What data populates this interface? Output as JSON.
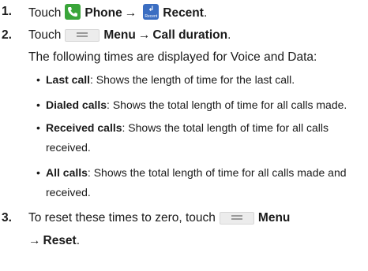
{
  "steps": [
    {
      "number": "1.",
      "prefix": "Touch",
      "phone_label": "Phone",
      "arrow": "→",
      "recent_label": "Recent",
      "recent_icon_caption": "Recent",
      "suffix": "."
    },
    {
      "number": "2.",
      "prefix": "Touch",
      "menu_label": "Menu",
      "arrow": "→",
      "target_label": "Call duration",
      "suffix": "."
    },
    {
      "number": "3.",
      "text": "To reset these times to zero, touch",
      "menu_label": "Menu",
      "arrow": "→",
      "target_label": "Reset",
      "suffix": "."
    }
  ],
  "intro": "The following times are displayed for Voice and Data:",
  "bullets": [
    {
      "term": "Last call",
      "desc": ": Shows the length of time for the last call."
    },
    {
      "term": "Dialed calls",
      "desc": ": Shows the total length of time for all calls made."
    },
    {
      "term": "Received calls",
      "desc": ": Shows the total length of time for all calls received."
    },
    {
      "term": "All calls",
      "desc": ": Shows the total length of time for all calls made and received."
    }
  ],
  "bullet_glyph": "•",
  "icons": [
    "phone-icon",
    "recent-icon",
    "menu-icon"
  ],
  "colors": {
    "phone_icon": "#3aa53a",
    "recent_icon": "#3b6ec2",
    "menu_icon": "#ececec"
  }
}
